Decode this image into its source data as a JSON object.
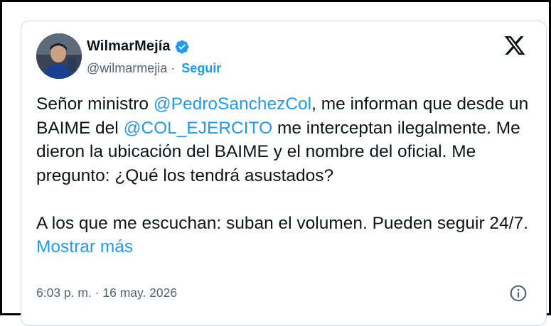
{
  "author": {
    "name": "WilmarMejía",
    "handle": "@wilmarmejia",
    "separator": " · ",
    "follow_label": "Seguir",
    "verified_icon": "verified-badge-icon"
  },
  "tweet": {
    "line1_a": "Señor ministro ",
    "mention1": "@PedroSanchezCol",
    "line1_b": ", me informan que desde un BAIME del ",
    "mention2": "@COL_EJERCITO",
    "line1_c": " me interceptan ilegalmente. Me dieron la ubicación del BAIME y el nombre del oficial. Me pregunto: ¿Qué los tendrá asustados?",
    "para2": "A los que me escuchan: suban el volumen. Pueden seguir 24/7. ",
    "show_more": "Mostrar más"
  },
  "meta": {
    "timestamp": "6:03 p. m. · 16 may. 2026"
  },
  "colors": {
    "link": "#1d9bf0",
    "text": "#0f1419",
    "secondary": "#536471",
    "border": "#cfd9de"
  },
  "icons": {
    "logo": "x-logo-icon",
    "info": "info-icon"
  }
}
